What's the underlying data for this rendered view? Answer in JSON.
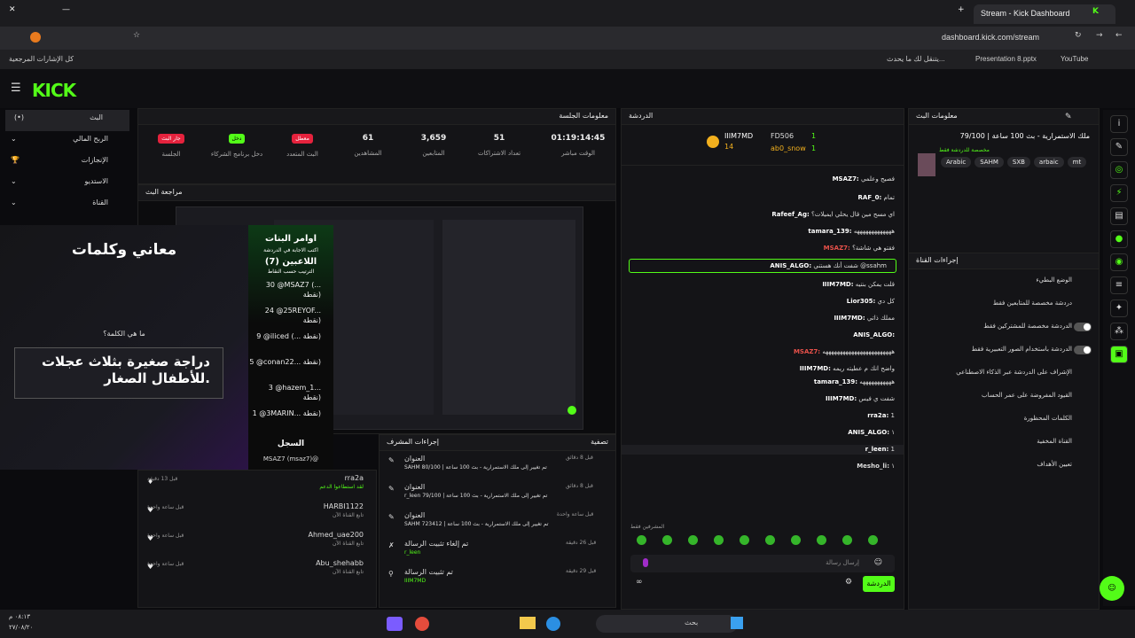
{
  "browser": {
    "tab_title": "Stream - Kick Dashboard",
    "url": "dashboard.kick.com/stream",
    "bookmarks": [
      "كل الإشارات المرجعية",
      "يتنقل لك ما يحدث...",
      "Presentation 8.pptx",
      "YouTube"
    ]
  },
  "sidebar": {
    "items": [
      "البث",
      "الربح المالي",
      "الإنجازات",
      "الاستديو",
      "القناة"
    ]
  },
  "session": {
    "title": "معلومات الجلسة",
    "stats": [
      {
        "pill": "جار البث",
        "label": "الجلسة",
        "color": "#e5223d"
      },
      {
        "pill": "دخل",
        "label": "دخل برنامج الشركاء",
        "color": "#53fc18"
      },
      {
        "pill": "معطل",
        "label": "البث المتعدد",
        "color": "#e5223d"
      },
      {
        "value": "61",
        "label": "المشاهدين"
      },
      {
        "value": "3,659",
        "label": "المتابعين"
      },
      {
        "value": "51",
        "label": "تعداد الاشتراكات"
      },
      {
        "value": "01:19:14:45",
        "label": "الوقت مباشر"
      }
    ],
    "preview_title": "مراجعة البث"
  },
  "overlay": {
    "title": "معاني وكلمات",
    "question_label": "ما هي الكلمة؟",
    "question": "دراجة صغيرة بثلاث عجلات للأطفال الصغار.",
    "lb_title": "اوامر البنات",
    "lb_sub": "اكتب الاجابة في الدردشة",
    "lb_players": "اللاعبين (7)",
    "lb_sort": "الترتيب حسب النقاط",
    "lb_rows": [
      "30 @MSAZ7 (... نقطة)",
      "24 @25REYOF... نقطة)",
      "9 @iliced (... نقطة)",
      "5 @conan22... نقطة)",
      "3 @hazem_1... نقطة)",
      "1 @3MARIN... نقطة)"
    ],
    "log_title": "السجل",
    "log_row": "MSAZ7 (msaz7)@"
  },
  "activity": {
    "tabs": [
      "تصفية",
      "إجراءات المشرف"
    ],
    "left_rows": [
      {
        "name": "rra2a",
        "sub": "لقد استطاعوا الدعم",
        "time": "قبل 13 دقيقة"
      },
      {
        "name": "HARBI1122",
        "sub": "تابع القناة الآن",
        "time": "قبل ساعة واحدة"
      },
      {
        "name": "Ahmed_uae200",
        "sub": "تابع القناة الآن",
        "time": "قبل ساعة واحدة"
      },
      {
        "name": "Abu_shehabb",
        "sub": "تابع القناة الآن",
        "time": "قبل ساعة واحدة"
      }
    ],
    "mod_rows": [
      {
        "title": "العنوان",
        "detail": "SAHM تم تغيير إلى ملك الاستمرارية - بث 100 ساعة | 80/100",
        "time": "قبل 8 دقائق"
      },
      {
        "title": "العنوان",
        "detail": "r_leen تم تغيير إلى ملك الاستمرارية - بث 100 ساعة | 79/100",
        "time": "قبل 8 دقائق"
      },
      {
        "title": "العنوان",
        "detail": "SAHM تم تغيير إلى ملك الاستمرارية - بث 100 ساعة | 723412",
        "time": "قبل ساعة واحدة"
      },
      {
        "title": "تم إلغاء تثبيت الرسالة",
        "detail": "r_leen",
        "time": "قبل 26 دقيقة"
      },
      {
        "title": "تم تثبيت الرسالة",
        "detail": "IIIM7MD",
        "time": "قبل 29 دقيقة"
      }
    ]
  },
  "chat": {
    "title": "الدردشة",
    "pinned_user": "IIIM7MD",
    "pinned_count": "14",
    "top_users": [
      {
        "name": "FD506",
        "n": "1"
      },
      {
        "name": "ab0_snow",
        "n": "1"
      }
    ],
    "messages": [
      {
        "u": "MSAZ7:",
        "t": "فصيح وعلمي"
      },
      {
        "u": "RAF_0:",
        "t": "تمام"
      },
      {
        "u": "Rafeef_Ag:",
        "t": "اي مسح مين قال يحلي ايميلات؟"
      },
      {
        "u": "tamara_139:",
        "t": "هههههههههههههه"
      },
      {
        "u": "MSAZ7:",
        "t": "فقتو هي شاشة؟"
      },
      {
        "u": "ANIS_ALGO:",
        "t": "شفت أنك هستني @ssahm"
      },
      {
        "u": "IIIM7MD:",
        "t": "قلت يمكن بنتيه"
      },
      {
        "u": "Lior305:",
        "t": "كل دي"
      },
      {
        "u": "IIIM7MD:",
        "t": "مملك ذاتي"
      },
      {
        "u": "ANIS_ALGO:",
        "t": ""
      },
      {
        "u": "MSAZ7:",
        "t": "ههههههههههههههههههههههههه"
      },
      {
        "u": "IIIM7MD:",
        "t": "واضح انك م عطيته ريمه"
      },
      {
        "u": "tamara_139:",
        "t": "هههههههههههه"
      },
      {
        "u": "IIIM7MD:",
        "t": "شفت ي فيس"
      },
      {
        "u": "rra2a:",
        "t": "1"
      },
      {
        "u": "ANIS_ALGO:",
        "t": "١"
      },
      {
        "u": "r_leen:",
        "t": "1"
      },
      {
        "u": "Mesho_li:",
        "t": "١"
      }
    ],
    "placeholder": "إرسال رسالة",
    "send": "الدردشة",
    "mod_label": "المشرفين فقط"
  },
  "stream_info": {
    "title": "معلومات البث",
    "stream_title": "ملك الاستمرارية - بث 100 ساعة | 79/100",
    "subtitle": "مخصصة للدردشة فقط",
    "tags": [
      "Arabic",
      "SAHM",
      "SXB",
      "arbaic",
      "mt"
    ]
  },
  "channel_actions": {
    "title": "إجراءات القناة",
    "items": [
      "الوضع البطيء",
      "دردشة مخصصة للمتابعين فقط",
      "الدردشة مخصصة للمشتركين فقط",
      "الدردشة باستخدام الصور التعبيرية فقط",
      "الإشراف على الدردشة عبر الذكاء الاصطناعي",
      "القيود المفروضة على عمر الحساب",
      "الكلمات المحظورة",
      "القناة المخفية",
      "تعيين الأهداف"
    ]
  },
  "taskbar": {
    "time": "٠٨:١٣ م",
    "date": "٢٧/٠٨/٢٠",
    "search": "بحث"
  }
}
